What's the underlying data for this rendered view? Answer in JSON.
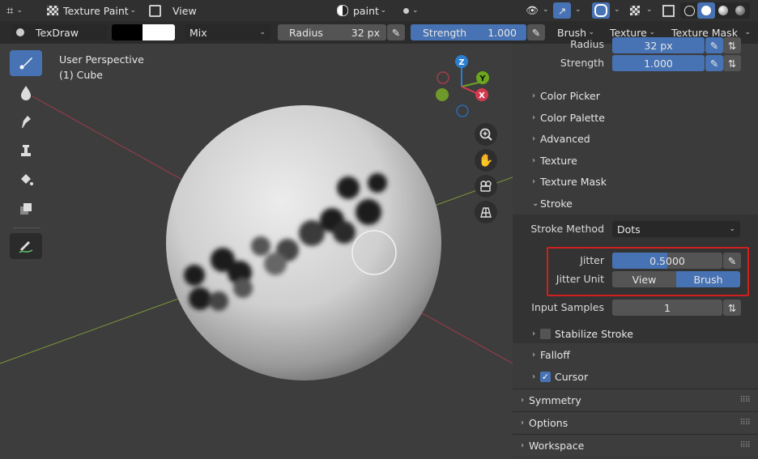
{
  "header": {
    "mode_label": "Texture Paint",
    "view_menu": "View",
    "paint_mode": "paint",
    "icons": [
      "transform-icon",
      "texture-paint-icon",
      "copy-icon",
      "eye-icon",
      "gizmo-icon",
      "overlay-icon",
      "xray-icon",
      "wireframe-icon",
      "solid-icon",
      "material-icon",
      "rendered-icon"
    ]
  },
  "toolbar": {
    "brush_name": "TexDraw",
    "color_primary": "#000000",
    "color_secondary": "#ffffff",
    "blend_mode": "Mix",
    "radius_label": "Radius",
    "radius_value": "32 px",
    "strength_label": "Strength",
    "strength_value": "1.000",
    "strength_fill": 1.0,
    "brush_menu": "Brush",
    "texture_menu": "Texture",
    "texture_mask_menu": "Texture Mask"
  },
  "viewport": {
    "perspective_label": "User Perspective",
    "object_label": "(1) Cube",
    "gizmo": {
      "z": "Z",
      "y": "Y",
      "x": "X"
    }
  },
  "tools": [
    "draw-brush-icon",
    "soften-brush-icon",
    "smear-brush-icon",
    "clone-brush-icon",
    "fill-brush-icon",
    "mask-brush-icon",
    "annotate-icon"
  ],
  "sidebar": {
    "radius_label": "Radius",
    "radius_value": "32 px",
    "strength_label": "Strength",
    "strength_value": "1.000",
    "sections": {
      "color_picker": "Color Picker",
      "color_palette": "Color Palette",
      "advanced": "Advanced",
      "texture": "Texture",
      "texture_mask": "Texture Mask",
      "stroke": "Stroke",
      "stabilize_stroke": "Stabilize Stroke",
      "falloff": "Falloff",
      "cursor": "Cursor",
      "symmetry": "Symmetry",
      "options": "Options",
      "workspace": "Workspace"
    },
    "stroke": {
      "method_label": "Stroke Method",
      "method_value": "Dots",
      "jitter_label": "Jitter",
      "jitter_value": "0.5000",
      "jitter_fill": 0.5,
      "jitter_unit_label": "Jitter Unit",
      "jitter_unit_view": "View",
      "jitter_unit_brush": "Brush",
      "jitter_unit_selected": "Brush",
      "input_samples_label": "Input Samples",
      "input_samples_value": "1",
      "stabilize_checked": false,
      "cursor_checked": true
    },
    "highlight_color": "#d11f1f",
    "accent_color": "#4772b3"
  }
}
